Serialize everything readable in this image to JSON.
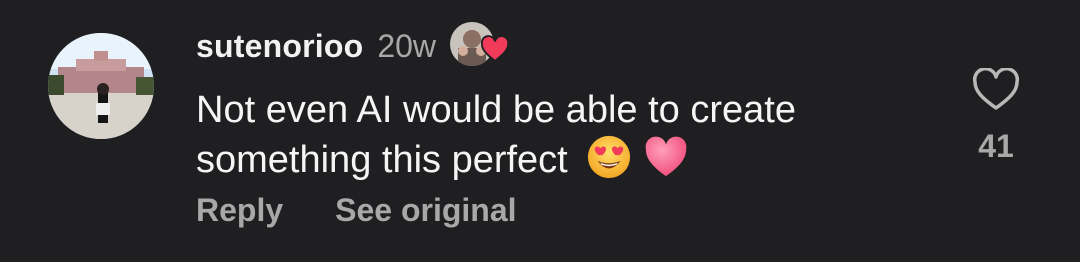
{
  "comment": {
    "username": "sutenorioo",
    "time_ago": "20w",
    "text": "Not even AI would be able to create something this perfect",
    "emojis": [
      "smiling-face-with-heart-eyes-icon",
      "pink-heart-icon"
    ],
    "like_count": "41"
  },
  "actions": {
    "reply_label": "Reply",
    "see_original_label": "See original"
  },
  "colors": {
    "background": "#1f1f21",
    "text": "#f5f5f5",
    "muted": "#a8a8a8",
    "heart": "#f23a5a"
  }
}
